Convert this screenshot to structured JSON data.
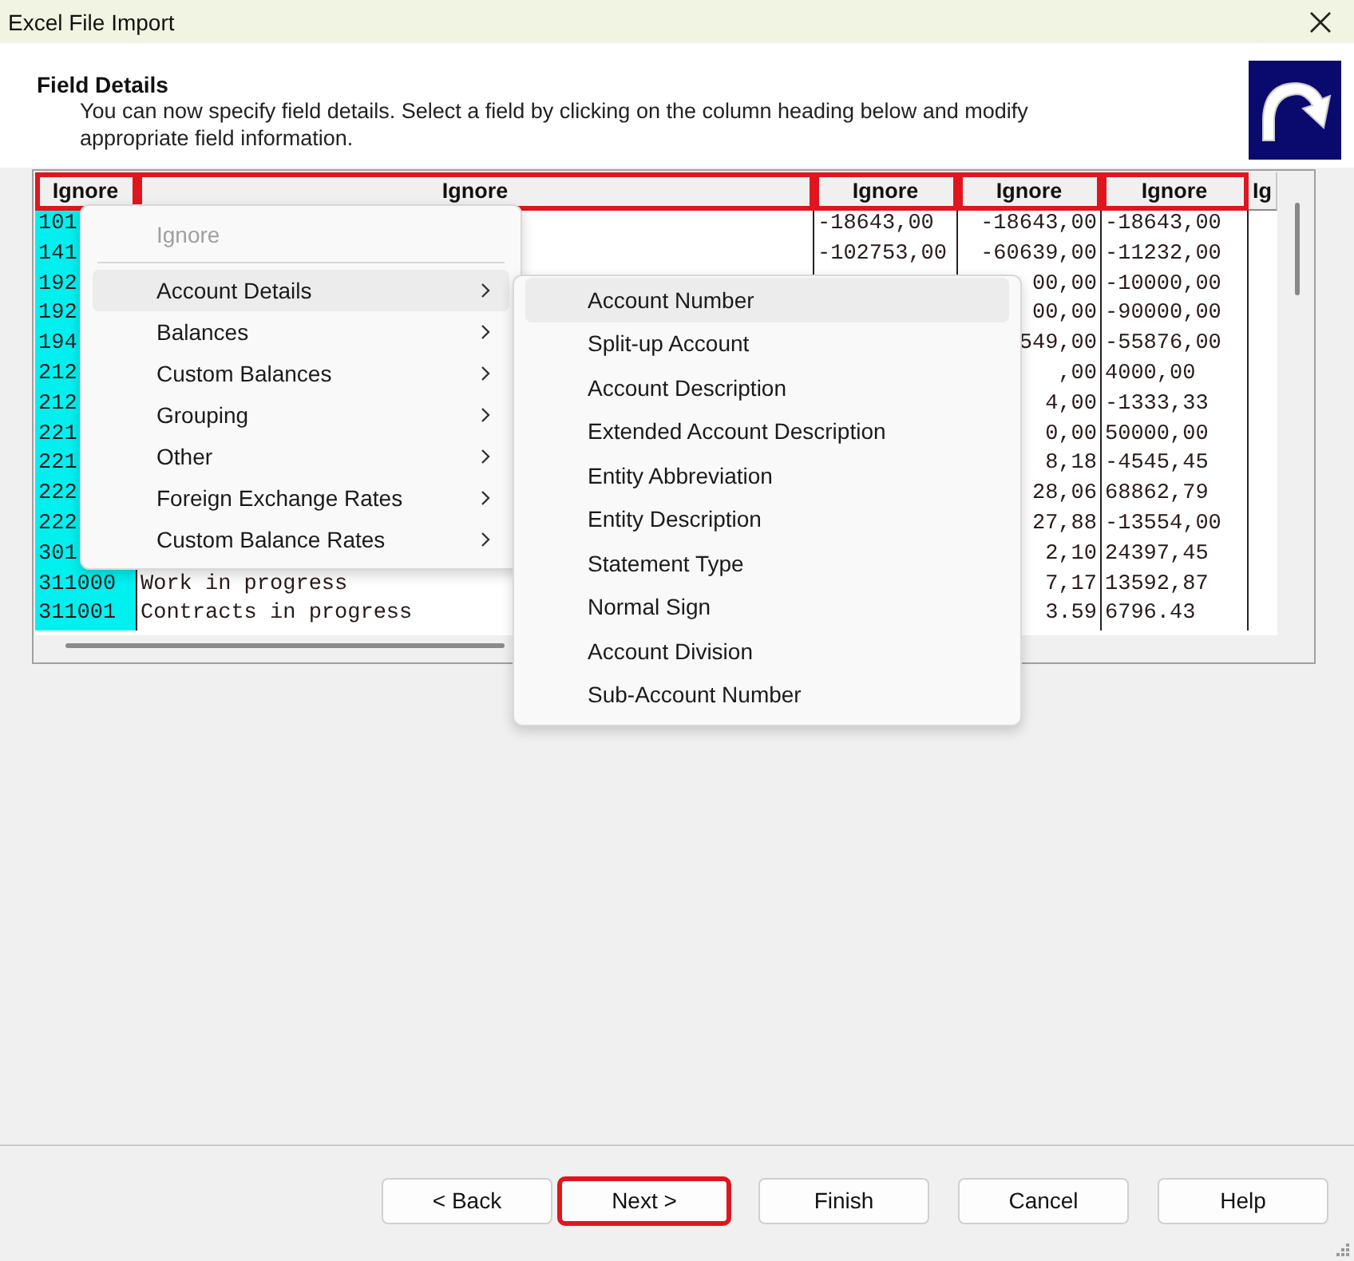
{
  "window": {
    "title": "Excel File Import"
  },
  "header": {
    "title": "Field Details",
    "description": "You can now specify field details. Select a field by clicking on the column heading below and modify appropriate field information."
  },
  "table": {
    "columns": [
      {
        "heading": "Ignore",
        "highlighted": true,
        "selected": true
      },
      {
        "heading": "Ignore",
        "highlighted": true,
        "selected": false
      },
      {
        "heading": "Ignore",
        "highlighted": true,
        "selected": false
      },
      {
        "heading": "Ignore",
        "highlighted": true,
        "selected": false
      },
      {
        "heading": "Ignore",
        "highlighted": true,
        "selected": false
      },
      {
        "heading": "Ig",
        "highlighted": false,
        "selected": false
      }
    ],
    "rows": [
      {
        "column_1": "101",
        "column_3": "-18643,00",
        "column_4": "-18643,00",
        "column_5": "-18643,00"
      },
      {
        "column_1": "141",
        "column_3": "-102753,00",
        "column_4": "-60639,00",
        "column_5": "-11232,00"
      },
      {
        "column_1": "192",
        "column_4": "00,00",
        "column_5": "-10000,00"
      },
      {
        "column_1": "192",
        "column_4": "00,00",
        "column_5": "-90000,00"
      },
      {
        "column_1": "194",
        "column_4": "549,00",
        "column_5": "-55876,00"
      },
      {
        "column_1": "212",
        "column_4": ",00",
        "column_5": "4000,00"
      },
      {
        "column_1": "212",
        "column_4": "4,00",
        "column_5": "-1333,33"
      },
      {
        "column_1": "221",
        "column_4": "0,00",
        "column_5": "50000,00"
      },
      {
        "column_1": "221",
        "column_4": "8,18",
        "column_5": "-4545,45"
      },
      {
        "column_1": "222",
        "column_4": "28,06",
        "column_5": "68862,79"
      },
      {
        "column_1": "222",
        "column_4": "27,88",
        "column_5": "-13554,00"
      },
      {
        "column_1": "301",
        "column_4": "2,10",
        "column_5": "24397,45"
      },
      {
        "column_1": "311000",
        "column_2": "Work in progress",
        "column_4": "7,17",
        "column_5": "13592,87"
      },
      {
        "column_1": "311001",
        "column_2": "Contracts in progress",
        "column_4": "3.59",
        "column_5": "6796.43"
      }
    ]
  },
  "context_menu": {
    "items": [
      {
        "kind": "item",
        "label": "Ignore",
        "disabled": true,
        "selected": false,
        "submenu": false
      },
      {
        "kind": "separator"
      },
      {
        "kind": "item",
        "label": "Account Details",
        "disabled": false,
        "selected": true,
        "submenu": true
      },
      {
        "kind": "item",
        "label": "Balances",
        "disabled": false,
        "selected": false,
        "submenu": true
      },
      {
        "kind": "item",
        "label": "Custom Balances",
        "disabled": false,
        "selected": false,
        "submenu": true
      },
      {
        "kind": "item",
        "label": "Grouping",
        "disabled": false,
        "selected": false,
        "submenu": true
      },
      {
        "kind": "item",
        "label": "Other",
        "disabled": false,
        "selected": false,
        "submenu": true
      },
      {
        "kind": "item",
        "label": "Foreign Exchange Rates",
        "disabled": false,
        "selected": false,
        "submenu": true
      },
      {
        "kind": "item",
        "label": "Custom Balance Rates",
        "disabled": false,
        "selected": false,
        "submenu": true
      }
    ]
  },
  "submenu": {
    "items": [
      {
        "label": "Account Number",
        "selected": true
      },
      {
        "label": "Split-up Account",
        "selected": false
      },
      {
        "label": "Account Description",
        "selected": false
      },
      {
        "label": "Extended Account Description",
        "selected": false
      },
      {
        "label": "Entity Abbreviation",
        "selected": false
      },
      {
        "label": "Entity Description",
        "selected": false
      },
      {
        "label": "Statement Type",
        "selected": false
      },
      {
        "label": "Normal Sign",
        "selected": false
      },
      {
        "label": "Account Division",
        "selected": false
      },
      {
        "label": "Sub-Account Number",
        "selected": false
      }
    ]
  },
  "buttons": [
    {
      "label": "< Back",
      "highlighted": false
    },
    {
      "label": "Next >",
      "highlighted": true
    },
    {
      "label": "Finish",
      "highlighted": false
    },
    {
      "label": "Cancel",
      "highlighted": false
    },
    {
      "label": "Help",
      "highlighted": false
    }
  ]
}
